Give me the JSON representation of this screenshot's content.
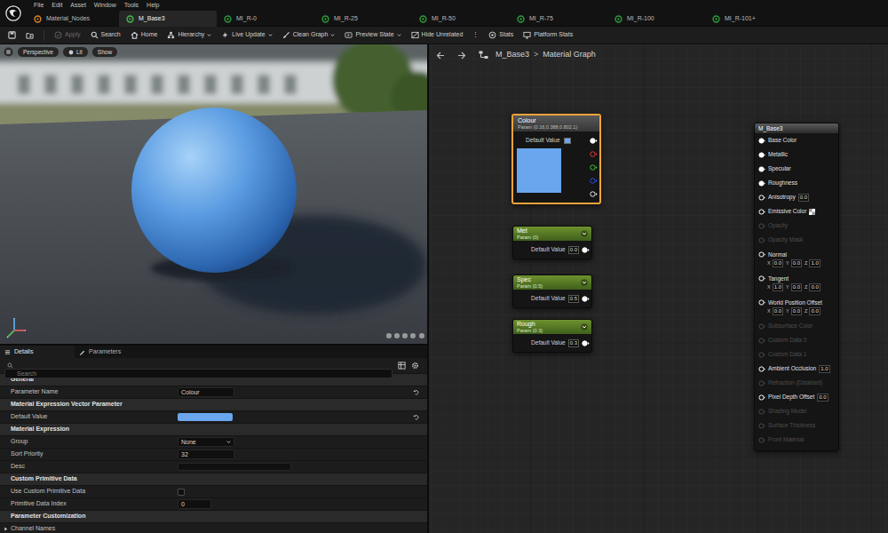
{
  "menu": [
    "File",
    "Edit",
    "Asset",
    "Window",
    "Tools",
    "Help"
  ],
  "tabs": [
    {
      "label": "Material_Nodes",
      "selected": false,
      "kind": "material"
    },
    {
      "label": "M_Base3",
      "selected": true,
      "kind": "graph"
    },
    {
      "label": "MI_R-0",
      "selected": false,
      "kind": "instance"
    },
    {
      "label": "MI_R-25",
      "selected": false,
      "kind": "instance"
    },
    {
      "label": "MI_R-50",
      "selected": false,
      "kind": "instance"
    },
    {
      "label": "MI_R-75",
      "selected": false,
      "kind": "instance"
    },
    {
      "label": "MI_R-100",
      "selected": false,
      "kind": "instance"
    },
    {
      "label": "MI_R-101+",
      "selected": false,
      "kind": "instance"
    }
  ],
  "toolbar": [
    {
      "label": "",
      "kind": "icon",
      "disabled": false
    },
    {
      "label": "",
      "kind": "icon",
      "disabled": false
    },
    {
      "label": "Apply",
      "kind": "button",
      "disabled": true
    },
    {
      "label": "Search",
      "kind": "button",
      "disabled": false
    },
    {
      "label": "Home",
      "kind": "button",
      "disabled": false
    },
    {
      "label": "Hierarchy",
      "kind": "dropdown",
      "disabled": false
    },
    {
      "label": "Live Update",
      "kind": "dropdown",
      "disabled": false
    },
    {
      "label": "Clean Graph",
      "kind": "dropdown",
      "disabled": false
    },
    {
      "label": "Preview State",
      "kind": "dropdown",
      "disabled": false
    },
    {
      "label": "Hide Unrelated",
      "kind": "button",
      "disabled": false
    },
    {
      "label": "⋮",
      "kind": "glyph",
      "disabled": false
    },
    {
      "label": "Stats",
      "kind": "button",
      "disabled": false
    },
    {
      "label": "Platform Stats",
      "kind": "button",
      "disabled": false
    }
  ],
  "viewport": {
    "buttons": [
      "Perspective",
      "Lit",
      "Show"
    ]
  },
  "details": {
    "tabs": [
      {
        "label": "Details",
        "selected": true
      },
      {
        "label": "Parameters",
        "selected": false
      }
    ],
    "search": {
      "placeholder": "Search"
    },
    "sections": [
      {
        "title": "General",
        "rows": [
          {
            "label": "Parameter Name",
            "kind": "text",
            "value": "Colour",
            "resettable": true
          }
        ]
      },
      {
        "title": "Material Expression Vector Parameter",
        "rows": [
          {
            "label": "Default Value",
            "kind": "color",
            "color": "#6aa6ee",
            "resettable": true
          }
        ]
      },
      {
        "title": "Material Expression",
        "rows": [
          {
            "label": "Group",
            "kind": "dropdown",
            "value": "None",
            "resettable": false
          },
          {
            "label": "Sort Priority",
            "kind": "text",
            "value": "32",
            "resettable": false
          },
          {
            "label": "Desc",
            "kind": "multiline",
            "value": "",
            "resettable": false
          }
        ]
      },
      {
        "title": "Custom Primitive Data",
        "rows": [
          {
            "label": "Use Custom Primitive Data",
            "kind": "checkbox",
            "checked": false,
            "resettable": false
          },
          {
            "label": "Primitive Data Index",
            "kind": "number",
            "value": "0",
            "resettable": false
          }
        ]
      },
      {
        "title": "Parameter Customization",
        "rows": [
          {
            "label": "Channel Names",
            "kind": "expander",
            "expanded": false,
            "resettable": false
          }
        ]
      }
    ]
  },
  "graph": {
    "breadcrumb": [
      "M_Base3",
      "Material Graph"
    ],
    "separator": ">",
    "nodes": [
      {
        "title": "Colour",
        "subtitle": "Param (0.16,0.388,0.802,1)",
        "kind": "vector",
        "selected": true,
        "label": "Default Value",
        "color": "#6aa6ee",
        "target": "Base Color",
        "outputs": [
          {
            "color": "#ffffff",
            "connected": true
          },
          {
            "color": "#e03a3a",
            "connected": false
          },
          {
            "color": "#3ac43a",
            "connected": false
          },
          {
            "color": "#2a4fe0",
            "connected": false
          },
          {
            "color": "#e8e8e8",
            "connected": false
          }
        ]
      },
      {
        "title": "Met",
        "subtitle": "Param (0)",
        "kind": "scalar",
        "selected": false,
        "label": "Default Value",
        "value": "0.0",
        "target": "Metallic"
      },
      {
        "title": "Spec",
        "subtitle": "Param (0.5)",
        "kind": "scalar",
        "selected": false,
        "label": "Default Value",
        "value": "0.5",
        "target": "Specular"
      },
      {
        "title": "Rough",
        "subtitle": "Param (0.3)",
        "kind": "scalar",
        "selected": false,
        "label": "Default Value",
        "value": "0.3",
        "target": "Roughness"
      }
    ],
    "result": {
      "title": "M_Base3",
      "inputs": [
        {
          "label": "Base Color",
          "kind": "pin",
          "enabled": true,
          "connected": true
        },
        {
          "label": "Metallic",
          "kind": "pin",
          "enabled": true,
          "connected": true
        },
        {
          "label": "Specular",
          "kind": "pin",
          "enabled": true,
          "connected": true
        },
        {
          "label": "Roughness",
          "kind": "pin",
          "enabled": true,
          "connected": true
        },
        {
          "label": "Anisotropy",
          "kind": "scalar",
          "value": "0.0",
          "enabled": true,
          "connected": false
        },
        {
          "label": "Emissive Color",
          "kind": "color",
          "enabled": true,
          "connected": false
        },
        {
          "label": "Opacity",
          "kind": "pin",
          "enabled": false,
          "connected": false
        },
        {
          "label": "Opacity Mask",
          "kind": "pin",
          "enabled": false,
          "connected": false
        },
        {
          "label": "Normal",
          "kind": "vector",
          "axes": [
            "X",
            "Y",
            "Z"
          ],
          "values": [
            "0.0",
            "0.0",
            "1.0"
          ],
          "enabled": true,
          "connected": false
        },
        {
          "label": "Tangent",
          "kind": "vector",
          "axes": [
            "X",
            "Y",
            "Z"
          ],
          "values": [
            "1.0",
            "0.0",
            "0.0"
          ],
          "enabled": true,
          "connected": false
        },
        {
          "label": "World Position Offset",
          "kind": "vector",
          "axes": [
            "X",
            "Y",
            "Z"
          ],
          "values": [
            "0.0",
            "0.0",
            "0.0"
          ],
          "enabled": true,
          "connected": false
        },
        {
          "label": "Subsurface Color",
          "kind": "pin",
          "enabled": false,
          "connected": false
        },
        {
          "label": "Custom Data 0",
          "kind": "pin",
          "enabled": false,
          "connected": false
        },
        {
          "label": "Custom Data 1",
          "kind": "pin",
          "enabled": false,
          "connected": false
        },
        {
          "label": "Ambient Occlusion",
          "kind": "scalar",
          "value": "1.0",
          "enabled": true,
          "connected": false
        },
        {
          "label": "Refraction (Disabled)",
          "kind": "pin",
          "enabled": false,
          "connected": false
        },
        {
          "label": "Pixel Depth Offset",
          "kind": "scalar",
          "value": "0.0",
          "enabled": true,
          "connected": false
        },
        {
          "label": "Shading Model",
          "kind": "pin",
          "enabled": false,
          "connected": false
        },
        {
          "label": "Surface Thickness",
          "kind": "pin",
          "enabled": false,
          "connected": false
        },
        {
          "label": "Front Material",
          "kind": "pin",
          "enabled": false,
          "connected": false
        }
      ]
    }
  }
}
